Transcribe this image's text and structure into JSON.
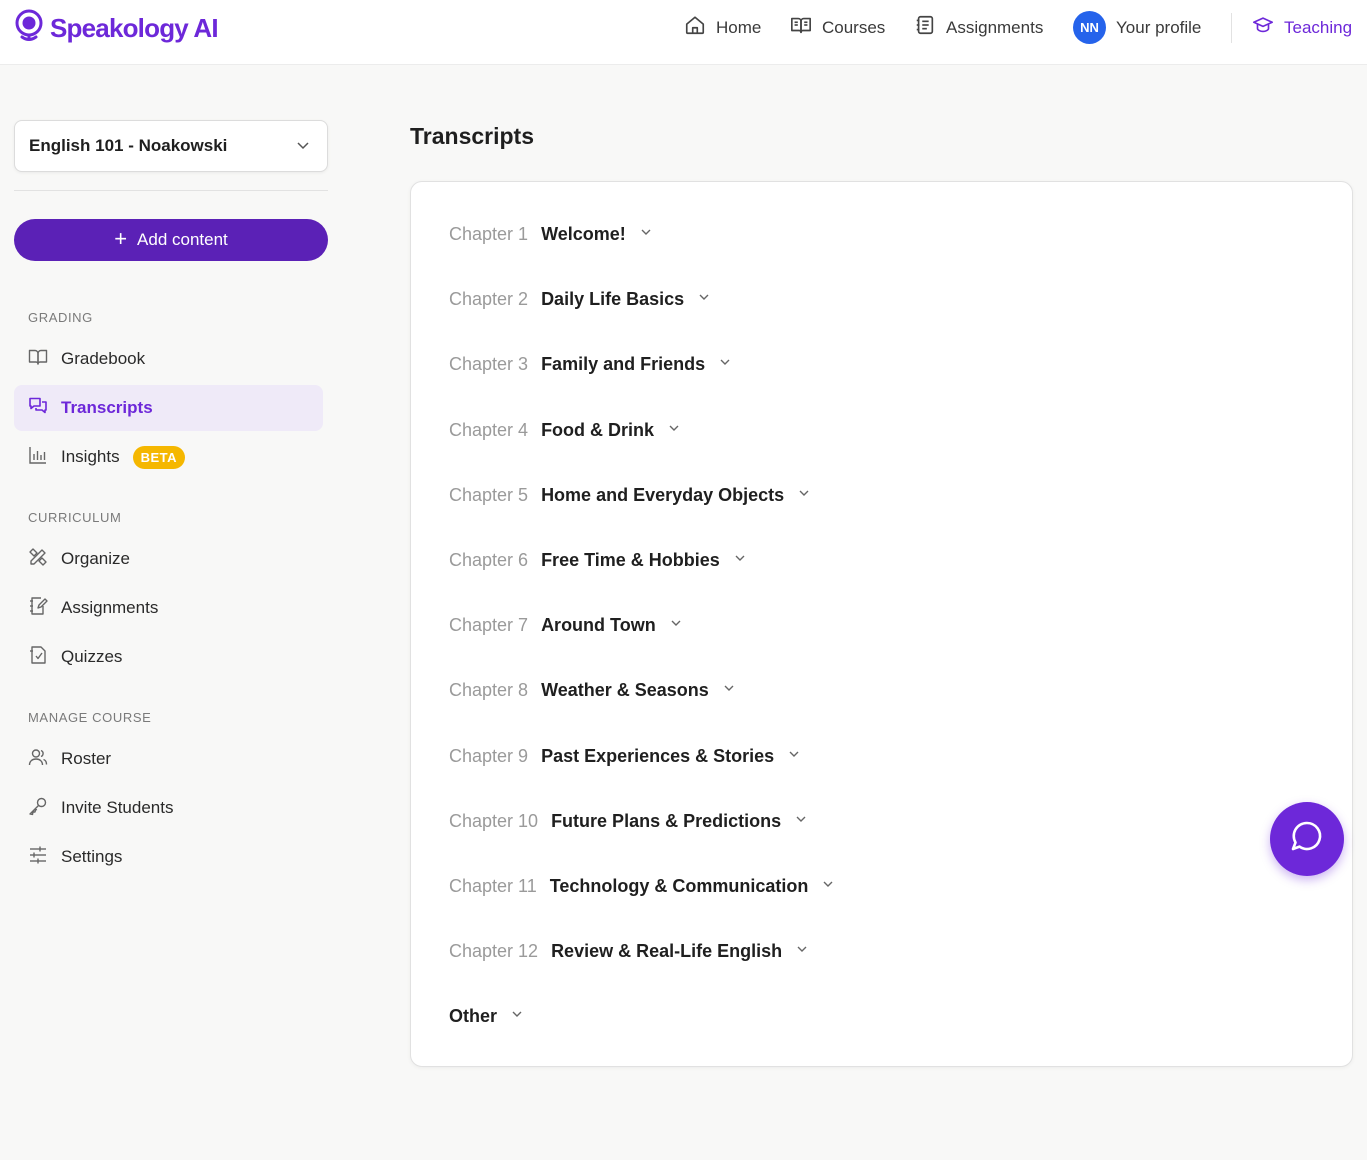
{
  "app": {
    "logo_text": "Speakology AI"
  },
  "topnav": {
    "home": "Home",
    "courses": "Courses",
    "assignments": "Assignments",
    "avatar_initials": "NN",
    "profile": "Your profile",
    "teaching": "Teaching"
  },
  "sidebar": {
    "course_selected": "English 101 - Noakowski",
    "add_content": "Add content",
    "sections": {
      "grading": "GRADING",
      "curriculum": "CURRICULUM",
      "manage": "MANAGE COURSE"
    },
    "items": {
      "gradebook": "Gradebook",
      "transcripts": "Transcripts",
      "insights": "Insights",
      "insights_badge": "BETA",
      "organize": "Organize",
      "assignments": "Assignments",
      "quizzes": "Quizzes",
      "roster": "Roster",
      "invite": "Invite Students",
      "settings": "Settings"
    },
    "active_item": "transcripts"
  },
  "main": {
    "title": "Transcripts",
    "chapters": [
      {
        "num": "Chapter 1",
        "title": "Welcome!"
      },
      {
        "num": "Chapter 2",
        "title": "Daily Life Basics"
      },
      {
        "num": "Chapter 3",
        "title": "Family and Friends"
      },
      {
        "num": "Chapter 4",
        "title": "Food & Drink"
      },
      {
        "num": "Chapter 5",
        "title": "Home and Everyday Objects"
      },
      {
        "num": "Chapter 6",
        "title": "Free Time & Hobbies"
      },
      {
        "num": "Chapter 7",
        "title": "Around Town"
      },
      {
        "num": "Chapter 8",
        "title": "Weather & Seasons"
      },
      {
        "num": "Chapter 9",
        "title": "Past Experiences & Stories"
      },
      {
        "num": "Chapter 10",
        "title": "Future Plans & Predictions"
      },
      {
        "num": "Chapter 11",
        "title": "Technology & Communication"
      },
      {
        "num": "Chapter 12",
        "title": "Review & Real-Life English"
      },
      {
        "num": "",
        "title": "Other"
      }
    ]
  },
  "icons": {
    "logo": "globe-chat-icon",
    "home": "home-icon",
    "courses": "open-book-icon",
    "assignments": "notebook-icon",
    "teaching": "graduation-cap-icon",
    "chat": "chat-bubble-icon"
  },
  "colors": {
    "brand": "#6d28d9",
    "add_button": "#5b21b6",
    "avatar": "#2563eb",
    "beta_badge": "#f5b700",
    "active_bg": "#efeaf8"
  }
}
